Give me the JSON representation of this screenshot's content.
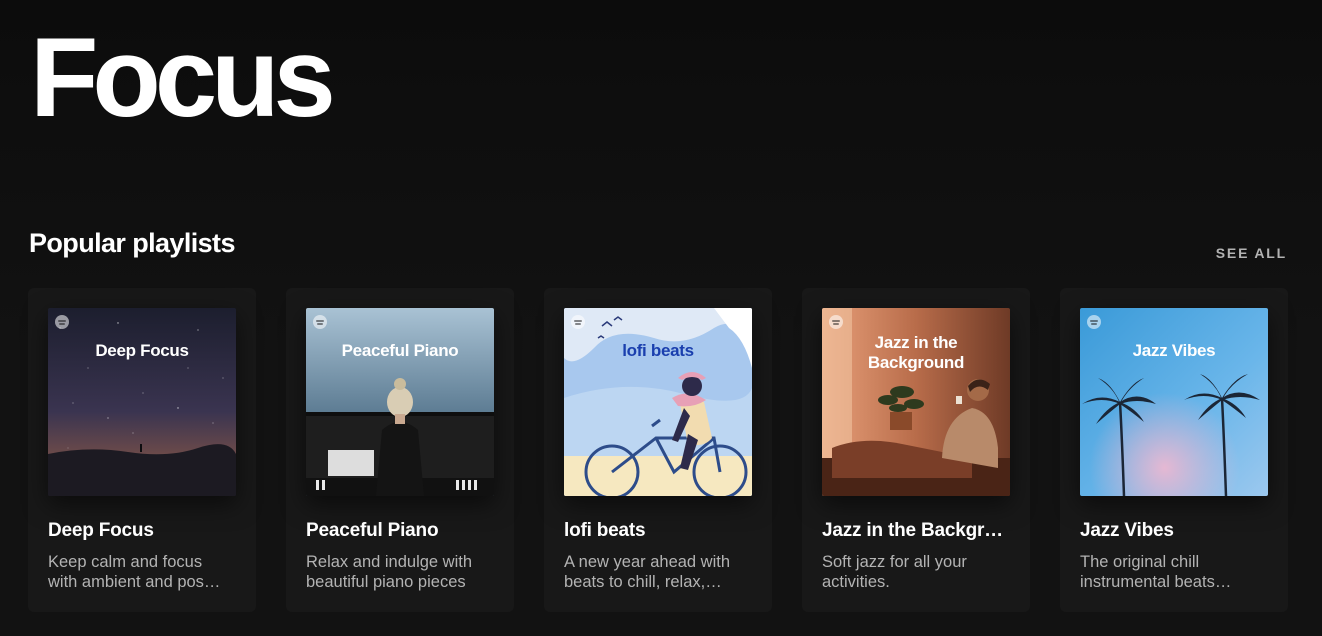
{
  "page": {
    "title": "Focus"
  },
  "section": {
    "title": "Popular playlists",
    "see_all": "SEE ALL"
  },
  "playlists": [
    {
      "title": "Deep Focus",
      "cover_text": "Deep Focus",
      "description": "Keep calm and focus with ambient and pos…"
    },
    {
      "title": "Peaceful Piano",
      "cover_text": "Peaceful Piano",
      "description": "Relax and indulge with beautiful piano pieces"
    },
    {
      "title": "lofi beats",
      "cover_text": "lofi beats",
      "description": "A new year ahead with beats to chill, relax,…"
    },
    {
      "title": "Jazz in the Backgr…",
      "cover_text": "Jazz in the Background",
      "description": "Soft jazz for all your activities."
    },
    {
      "title": "Jazz Vibes",
      "cover_text": "Jazz Vibes",
      "description": "The original chill instrumental beats…"
    }
  ],
  "colors": {
    "background": "#121212",
    "card": "#181818",
    "text_primary": "#ffffff",
    "text_secondary": "#b3b3b3"
  }
}
